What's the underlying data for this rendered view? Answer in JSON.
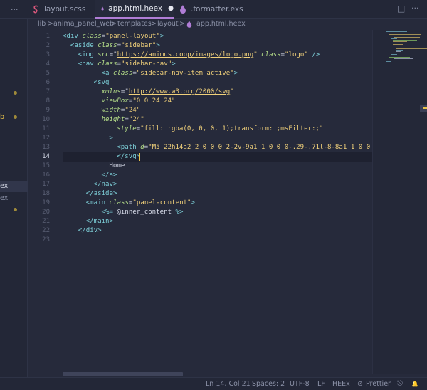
{
  "left_panel": {
    "fragments": [
      "b",
      "ex",
      "ex"
    ]
  },
  "tabs": {
    "more": "···",
    "items": [
      {
        "label": "layout.scss",
        "icon": "sass-file-icon",
        "color": "#d9577b"
      },
      {
        "label": "app.html.heex",
        "icon": "elixir-file-icon",
        "color": "#b07dd6",
        "dirty": "●"
      },
      {
        "label": ".formatter.exs",
        "icon": "elixir-file-icon",
        "color": "#b07dd6"
      }
    ],
    "split_icon": "◫",
    "more_actions": "···"
  },
  "breadcrumb": {
    "items": [
      "lib",
      "anima_panel_web",
      "templates",
      "layout",
      "app.html.heex"
    ],
    "separator": ">"
  },
  "editor": {
    "line_numbers": [
      "1",
      "2",
      "3",
      "4",
      "5",
      "6",
      "7",
      "8",
      "9",
      "10",
      "11",
      "12",
      "13",
      "14",
      "15",
      "16",
      "17",
      "18",
      "19",
      "20",
      "21",
      "22",
      "23"
    ],
    "current_line": "14",
    "lines": [
      [
        {
          "c": "t",
          "v": "<div "
        },
        {
          "c": "a",
          "v": "class"
        },
        {
          "c": "p",
          "v": "="
        },
        {
          "c": "s",
          "v": "\"panel-layout\""
        },
        {
          "c": "t",
          "v": ">"
        }
      ],
      [
        {
          "c": "t",
          "v": "<aside "
        },
        {
          "c": "a",
          "v": "class"
        },
        {
          "c": "p",
          "v": "="
        },
        {
          "c": "s",
          "v": "\"sidebar\""
        },
        {
          "c": "t",
          "v": ">"
        }
      ],
      [
        {
          "c": "t",
          "v": "<img "
        },
        {
          "c": "a",
          "v": "src"
        },
        {
          "c": "p",
          "v": "=\""
        },
        {
          "c": "u",
          "v": "https://animus.coop/images/logo.png"
        },
        {
          "c": "s",
          "v": "\" "
        },
        {
          "c": "a",
          "v": "class"
        },
        {
          "c": "p",
          "v": "="
        },
        {
          "c": "s",
          "v": "\"logo\" "
        },
        {
          "c": "t",
          "v": "/>"
        }
      ],
      [
        {
          "c": "t",
          "v": "<nav "
        },
        {
          "c": "a",
          "v": "class"
        },
        {
          "c": "p",
          "v": "="
        },
        {
          "c": "s",
          "v": "\"sidebar-nav\""
        },
        {
          "c": "t",
          "v": ">"
        }
      ],
      [
        {
          "c": "t",
          "v": "<a "
        },
        {
          "c": "a",
          "v": "class"
        },
        {
          "c": "p",
          "v": "="
        },
        {
          "c": "s",
          "v": "\"sidebar-nav-item active\""
        },
        {
          "c": "t",
          "v": ">"
        }
      ],
      [
        {
          "c": "t",
          "v": "<svg"
        }
      ],
      [
        {
          "c": "a",
          "v": "xmlns"
        },
        {
          "c": "p",
          "v": "=\""
        },
        {
          "c": "u",
          "v": "http://www.w3.org/2000/svg"
        },
        {
          "c": "s",
          "v": "\""
        }
      ],
      [
        {
          "c": "a",
          "v": "viewBox"
        },
        {
          "c": "p",
          "v": "="
        },
        {
          "c": "s",
          "v": "\"0 0 24 24\""
        }
      ],
      [
        {
          "c": "a",
          "v": "width"
        },
        {
          "c": "p",
          "v": "="
        },
        {
          "c": "s",
          "v": "\"24\""
        }
      ],
      [
        {
          "c": "a",
          "v": "height"
        },
        {
          "c": "p",
          "v": "="
        },
        {
          "c": "s",
          "v": "\"24\""
        }
      ],
      [
        {
          "c": "a",
          "v": "style"
        },
        {
          "c": "p",
          "v": "="
        },
        {
          "c": "s",
          "v": "\"fill: rgba(0, 0, 0, 1);transform: ;msFilter:;\""
        }
      ],
      [
        {
          "c": "t",
          "v": ">"
        }
      ],
      [
        {
          "c": "t",
          "v": "<path "
        },
        {
          "c": "a",
          "v": "d"
        },
        {
          "c": "p",
          "v": "="
        },
        {
          "c": "s",
          "v": "\"M5 22h14a2 2 0 0 0 2-2v-9a1 1 0 0 0-.29-.71l-8-8a1 1 0 0"
        }
      ],
      [
        {
          "c": "t",
          "v": "</svg>"
        }
      ],
      [
        {
          "c": "x",
          "v": "Home"
        }
      ],
      [
        {
          "c": "t",
          "v": "</a>"
        }
      ],
      [
        {
          "c": "t",
          "v": "</nav>"
        }
      ],
      [
        {
          "c": "t",
          "v": "</aside>"
        }
      ],
      [
        {
          "c": "t",
          "v": "<main "
        },
        {
          "c": "a",
          "v": "class"
        },
        {
          "c": "p",
          "v": "="
        },
        {
          "c": "s",
          "v": "\"panel-content\""
        },
        {
          "c": "t",
          "v": ">"
        }
      ],
      [
        {
          "c": "t",
          "v": "<%= "
        },
        {
          "c": "x",
          "v": "@inner_content "
        },
        {
          "c": "t",
          "v": "%>"
        }
      ],
      [
        {
          "c": "t",
          "v": "</main>"
        }
      ],
      [
        {
          "c": "t",
          "v": "</div>"
        }
      ],
      []
    ]
  },
  "statusbar": {
    "position": "Ln 14, Col 21",
    "spaces": "Spaces: 2",
    "encoding": "UTF-8",
    "eol": "LF",
    "language": "HEEx",
    "formatter": "Prettier",
    "check_icon": "⊘",
    "share_icon": "⎋",
    "bell_icon": "🔔"
  },
  "colors": {
    "background": "#262a3b",
    "accent": "#b07dd6",
    "tag": "#7dcfd8",
    "attribute": "#b7e08a",
    "string": "#f0d07a",
    "cursor": "#e8c24a"
  }
}
